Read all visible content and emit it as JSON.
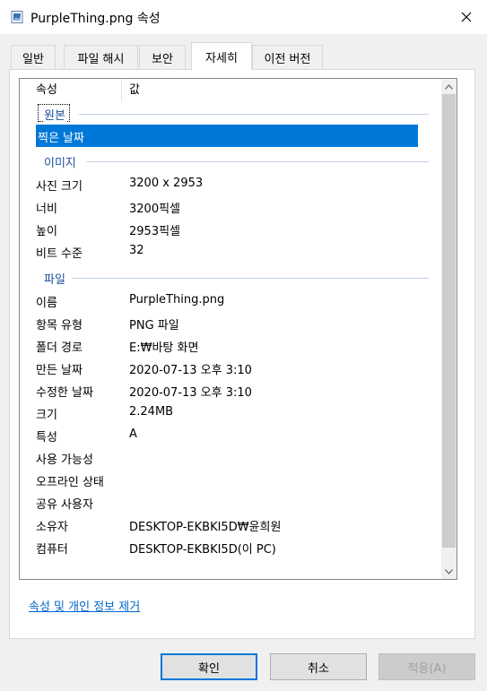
{
  "window": {
    "title": "PurpleThing.png 속성",
    "close_icon": "close-icon"
  },
  "tabs": [
    {
      "label": "일반"
    },
    {
      "label": "파일 해시"
    },
    {
      "label": "보안"
    },
    {
      "label": "자세히",
      "active": true
    },
    {
      "label": "이전 버전"
    }
  ],
  "grid": {
    "header": {
      "property": "속성",
      "value": "값"
    },
    "groups": {
      "origin": "원본",
      "image": "이미지",
      "file": "파일"
    },
    "selected_row": "찍은 날짜",
    "image_rows": [
      {
        "label": "사진 크기",
        "value": "3200 x 2953"
      },
      {
        "label": "너비",
        "value": "3200픽셀"
      },
      {
        "label": "높이",
        "value": "2953픽셀"
      },
      {
        "label": "비트 수준",
        "value": "32"
      }
    ],
    "file_rows": [
      {
        "label": "이름",
        "value": "PurpleThing.png"
      },
      {
        "label": "항목 유형",
        "value": "PNG 파일"
      },
      {
        "label": "폴더 경로",
        "value": "E:₩바탕 화면"
      },
      {
        "label": "만든 날짜",
        "value": "2020-07-13 오후 3:10"
      },
      {
        "label": "수정한 날짜",
        "value": "2020-07-13 오후 3:10"
      },
      {
        "label": "크기",
        "value": "2.24MB"
      },
      {
        "label": "특성",
        "value": "A"
      },
      {
        "label": "사용 가능성",
        "value": ""
      },
      {
        "label": "오프라인 상태",
        "value": ""
      },
      {
        "label": "공유 사용자",
        "value": ""
      },
      {
        "label": "소유자",
        "value": "DESKTOP-EKBKI5D₩윤희원"
      },
      {
        "label": "컴퓨터",
        "value": "DESKTOP-EKBKI5D(이 PC)"
      }
    ]
  },
  "link": {
    "remove_properties": "속성 및 개인 정보 제거"
  },
  "buttons": {
    "ok": "확인",
    "cancel": "취소",
    "apply": "적용(A)"
  },
  "colors": {
    "selection": "#0078d7",
    "group_text": "#1e4e9a",
    "link": "#0066cc"
  }
}
